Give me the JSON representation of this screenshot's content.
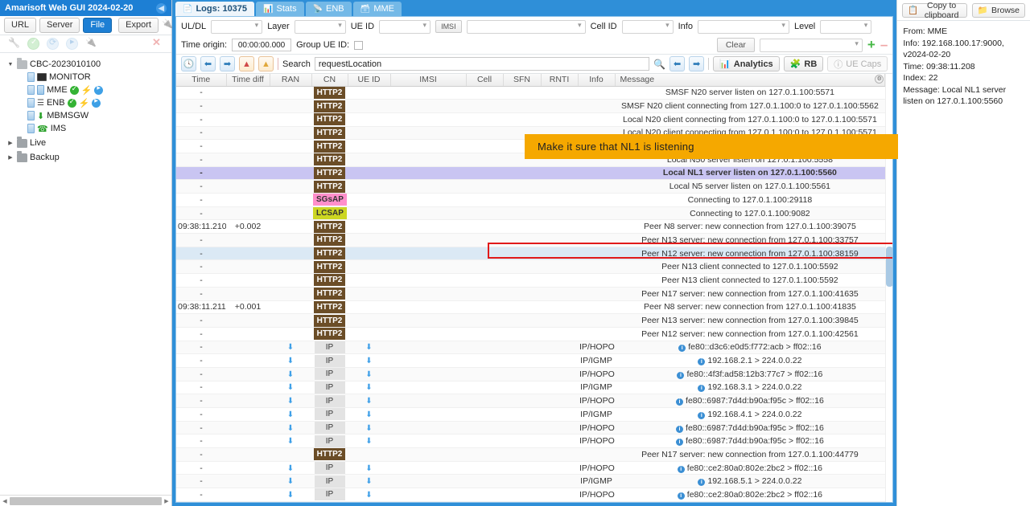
{
  "window": {
    "title": "Amarisoft Web GUI 2024-02-20",
    "collapse_icon": "chevron-left-icon"
  },
  "left_panel": {
    "buttons": [
      {
        "label": "URL",
        "active": false
      },
      {
        "label": "Server",
        "active": false
      },
      {
        "label": "File",
        "active": true
      },
      {
        "label": "Export",
        "active": false
      }
    ],
    "add_icon": "add-plug-icon",
    "tool_icons": [
      "wrench-icon",
      "check-circle-icon",
      "refresh-icon",
      "play-circle-icon",
      "plug-icon",
      "close-x-icon"
    ],
    "tree": [
      {
        "label": "CBC-2023010100",
        "type": "folder",
        "expanded": true,
        "depth": 0
      },
      {
        "label": "MONITOR",
        "type": "monitor",
        "depth": 1,
        "status": []
      },
      {
        "label": "MME",
        "type": "server",
        "depth": 1,
        "status": [
          "ok",
          "bolt",
          "play"
        ]
      },
      {
        "label": "ENB",
        "type": "enb",
        "depth": 1,
        "status": [
          "ok",
          "bolt",
          "play"
        ]
      },
      {
        "label": "MBMSGW",
        "type": "mbms",
        "depth": 1,
        "status": []
      },
      {
        "label": "IMS",
        "type": "ims",
        "depth": 1,
        "status": []
      },
      {
        "label": "Live",
        "type": "folder",
        "expanded": false,
        "depth": 0
      },
      {
        "label": "Backup",
        "type": "folder",
        "expanded": false,
        "depth": 0
      }
    ]
  },
  "tabs": [
    {
      "label": "Logs: 10375",
      "icon": "document-icon",
      "active": true
    },
    {
      "label": "Stats",
      "icon": "bar-chart-icon",
      "active": false
    },
    {
      "label": "ENB",
      "icon": "antenna-icon",
      "active": false
    },
    {
      "label": "MME",
      "icon": "server-icon",
      "active": false
    }
  ],
  "filters": {
    "uldl_label": "UL/DL",
    "uldl_value": "",
    "layer_label": "Layer",
    "layer_value": "",
    "ueid_label": "UE ID",
    "ueid_value": "",
    "imsi_button": "IMSI",
    "imsi_value": "",
    "cellid_label": "Cell ID",
    "cellid_value": "",
    "info_label": "Info",
    "info_value": "",
    "level_label": "Level",
    "level_value": "",
    "time_origin_label": "Time origin:",
    "time_origin_value": "00:00:00.000",
    "group_ueid_label": "Group UE ID:",
    "group_ueid_checked": false,
    "clear_label": "Clear",
    "preset_value": "",
    "add_icon": "plus-icon",
    "remove_icon": "minus-icon"
  },
  "toolbar": {
    "icons": [
      "clock-icon",
      "arrow-left-icon",
      "arrow-right-icon",
      "error-triangle-icon",
      "warning-triangle-icon"
    ],
    "search_label": "Search",
    "search_value": "requestLocation",
    "binoculars_icon": "binoculars-icon",
    "prev_icon": "arrow-left-icon",
    "next_icon": "arrow-right-icon",
    "analytics_label": "Analytics",
    "analytics_icon": "bar-chart-icon",
    "rb_label": "RB",
    "rb_icon": "puzzle-icon",
    "uecaps_label": "UE Caps",
    "uecaps_icon": "help-circle-icon",
    "uecaps_disabled": true
  },
  "table": {
    "columns": [
      "Time",
      "Time diff",
      "RAN",
      "CN",
      "UE ID",
      "IMSI",
      "Cell",
      "SFN",
      "RNTI",
      "Info",
      "Message"
    ],
    "settings_icon": "gear-icon",
    "rows": [
      {
        "time": "-",
        "diff": "",
        "ran": "",
        "cn": "HTTP2",
        "cn_type": "http2",
        "ueid": "",
        "info": "",
        "msg": "SMSF N20 server listen on 127.0.1.100:5571"
      },
      {
        "time": "-",
        "diff": "",
        "ran": "",
        "cn": "HTTP2",
        "cn_type": "http2",
        "ueid": "",
        "info": "",
        "msg": "SMSF N20 client connecting from 127.0.1.100:0 to 127.0.1.100:5562"
      },
      {
        "time": "-",
        "diff": "",
        "ran": "",
        "cn": "HTTP2",
        "cn_type": "http2",
        "ueid": "",
        "info": "",
        "msg": "Local N20 client connecting from 127.0.1.100:0 to 127.0.1.100:5571"
      },
      {
        "time": "-",
        "diff": "",
        "ran": "",
        "cn": "HTTP2",
        "cn_type": "http2",
        "ueid": "",
        "info": "",
        "msg": "Local N20 client connecting from 127.0.1.100:0 to 127.0.1.100:5571"
      },
      {
        "time": "-",
        "diff": "",
        "ran": "",
        "cn": "HTTP2",
        "cn_type": "http2",
        "ueid": "",
        "info": "",
        "msg": ""
      },
      {
        "time": "-",
        "diff": "",
        "ran": "",
        "cn": "HTTP2",
        "cn_type": "http2",
        "ueid": "",
        "info": "",
        "msg": "Local N50 server listen on 127.0.1.100:5558"
      },
      {
        "time": "-",
        "diff": "",
        "ran": "",
        "cn": "HTTP2",
        "cn_type": "http2",
        "ueid": "",
        "info": "",
        "msg": "Local NL1 server listen on 127.0.1.100:5560",
        "highlight": true
      },
      {
        "time": "-",
        "diff": "",
        "ran": "",
        "cn": "HTTP2",
        "cn_type": "http2",
        "ueid": "",
        "info": "",
        "msg": "Local N5 server listen on 127.0.1.100:5561"
      },
      {
        "time": "-",
        "diff": "",
        "ran": "",
        "cn": "SGsAP",
        "cn_type": "sgsap",
        "ueid": "",
        "info": "",
        "msg": "Connecting to 127.0.1.100:29118"
      },
      {
        "time": "-",
        "diff": "",
        "ran": "",
        "cn": "LCSAP",
        "cn_type": "lcsap",
        "ueid": "",
        "info": "",
        "msg": "Connecting to 127.0.1.100:9082"
      },
      {
        "time": "09:38:11.210",
        "diff": "+0.002",
        "ran": "",
        "cn": "HTTP2",
        "cn_type": "http2",
        "ueid": "",
        "info": "",
        "msg": "Peer N8 server: new connection from 127.0.1.100:39075"
      },
      {
        "time": "-",
        "diff": "",
        "ran": "",
        "cn": "HTTP2",
        "cn_type": "http2",
        "ueid": "",
        "info": "",
        "msg": "Peer N13 server: new connection from 127.0.1.100:33757"
      },
      {
        "time": "-",
        "diff": "",
        "ran": "",
        "cn": "HTTP2",
        "cn_type": "http2",
        "ueid": "",
        "info": "",
        "msg": "Peer N12 server: new connection from 127.0.1.100:38159",
        "selected": true
      },
      {
        "time": "-",
        "diff": "",
        "ran": "",
        "cn": "HTTP2",
        "cn_type": "http2",
        "ueid": "",
        "info": "",
        "msg": "Peer N13 client connected to 127.0.1.100:5592"
      },
      {
        "time": "-",
        "diff": "",
        "ran": "",
        "cn": "HTTP2",
        "cn_type": "http2",
        "ueid": "",
        "info": "",
        "msg": "Peer N13 client connected to 127.0.1.100:5592"
      },
      {
        "time": "-",
        "diff": "",
        "ran": "",
        "cn": "HTTP2",
        "cn_type": "http2",
        "ueid": "",
        "info": "",
        "msg": "Peer N17 server: new connection from 127.0.1.100:41635"
      },
      {
        "time": "09:38:11.211",
        "diff": "+0.001",
        "ran": "",
        "cn": "HTTP2",
        "cn_type": "http2",
        "ueid": "",
        "info": "",
        "msg": "Peer N8 server: new connection from 127.0.1.100:41835"
      },
      {
        "time": "-",
        "diff": "",
        "ran": "",
        "cn": "HTTP2",
        "cn_type": "http2",
        "ueid": "",
        "info": "",
        "msg": "Peer N13 server: new connection from 127.0.1.100:39845"
      },
      {
        "time": "-",
        "diff": "",
        "ran": "",
        "cn": "HTTP2",
        "cn_type": "http2",
        "ueid": "",
        "info": "",
        "msg": "Peer N12 server: new connection from 127.0.1.100:42561"
      },
      {
        "time": "-",
        "diff": "",
        "ran": "arrow",
        "cn": "IP",
        "cn_type": "ip",
        "ueid": "arrow",
        "info": "IP/HOPOPT",
        "msg": "fe80::d3c6:e0d5:f772:acb > ff02::16",
        "msg_badge": true
      },
      {
        "time": "-",
        "diff": "",
        "ran": "arrow",
        "cn": "IP",
        "cn_type": "ip",
        "ueid": "arrow",
        "info": "IP/IGMP",
        "msg": "192.168.2.1 > 224.0.0.22",
        "msg_badge": true
      },
      {
        "time": "-",
        "diff": "",
        "ran": "arrow",
        "cn": "IP",
        "cn_type": "ip",
        "ueid": "arrow",
        "info": "IP/HOPOPT",
        "msg": "fe80::4f3f:ad58:12b3:77c7 > ff02::16",
        "msg_badge": true
      },
      {
        "time": "-",
        "diff": "",
        "ran": "arrow",
        "cn": "IP",
        "cn_type": "ip",
        "ueid": "arrow",
        "info": "IP/IGMP",
        "msg": "192.168.3.1 > 224.0.0.22",
        "msg_badge": true
      },
      {
        "time": "-",
        "diff": "",
        "ran": "arrow",
        "cn": "IP",
        "cn_type": "ip",
        "ueid": "arrow",
        "info": "IP/HOPOPT",
        "msg": "fe80::6987:7d4d:b90a:f95c > ff02::16",
        "msg_badge": true
      },
      {
        "time": "-",
        "diff": "",
        "ran": "arrow",
        "cn": "IP",
        "cn_type": "ip",
        "ueid": "arrow",
        "info": "IP/IGMP",
        "msg": "192.168.4.1 > 224.0.0.22",
        "msg_badge": true
      },
      {
        "time": "-",
        "diff": "",
        "ran": "arrow",
        "cn": "IP",
        "cn_type": "ip",
        "ueid": "arrow",
        "info": "IP/HOPOPT",
        "msg": "fe80::6987:7d4d:b90a:f95c > ff02::16",
        "msg_badge": true
      },
      {
        "time": "-",
        "diff": "",
        "ran": "arrow",
        "cn": "IP",
        "cn_type": "ip",
        "ueid": "arrow",
        "info": "IP/HOPOPT",
        "msg": "fe80::6987:7d4d:b90a:f95c > ff02::16",
        "msg_badge": true
      },
      {
        "time": "-",
        "diff": "",
        "ran": "",
        "cn": "HTTP2",
        "cn_type": "http2",
        "ueid": "",
        "info": "",
        "msg": "Peer N17 server: new connection from 127.0.1.100:44779"
      },
      {
        "time": "-",
        "diff": "",
        "ran": "arrow",
        "cn": "IP",
        "cn_type": "ip",
        "ueid": "arrow",
        "info": "IP/HOPOPT",
        "msg": "fe80::ce2:80a0:802e:2bc2 > ff02::16",
        "msg_badge": true
      },
      {
        "time": "-",
        "diff": "",
        "ran": "arrow",
        "cn": "IP",
        "cn_type": "ip",
        "ueid": "arrow",
        "info": "IP/IGMP",
        "msg": "192.168.5.1 > 224.0.0.22",
        "msg_badge": true
      },
      {
        "time": "-",
        "diff": "",
        "ran": "arrow",
        "cn": "IP",
        "cn_type": "ip",
        "ueid": "arrow",
        "info": "IP/HOPOPT",
        "msg": "fe80::ce2:80a0:802e:2bc2 > ff02::16",
        "msg_badge": true
      }
    ]
  },
  "callout": {
    "text": "Make it sure that NL1 is listening",
    "bg": "#f5a800"
  },
  "right_panel": {
    "copy_label": "Copy to clipboard",
    "copy_icon": "copy-icon",
    "browse_label": "Browse",
    "browse_icon": "folder-icon",
    "details": [
      "From: MME",
      "Info: 192.168.100.17:9000, v2024-02-20",
      "Time: 09:38:11.208",
      "Index: 22",
      "Message: Local NL1 server listen on 127.0.1.100:5560"
    ]
  },
  "colors": {
    "accent": "#1d7fd4",
    "highlight_row": "#c9c5f2",
    "highlight_border": "#e11a1a",
    "callout": "#f5a800"
  }
}
